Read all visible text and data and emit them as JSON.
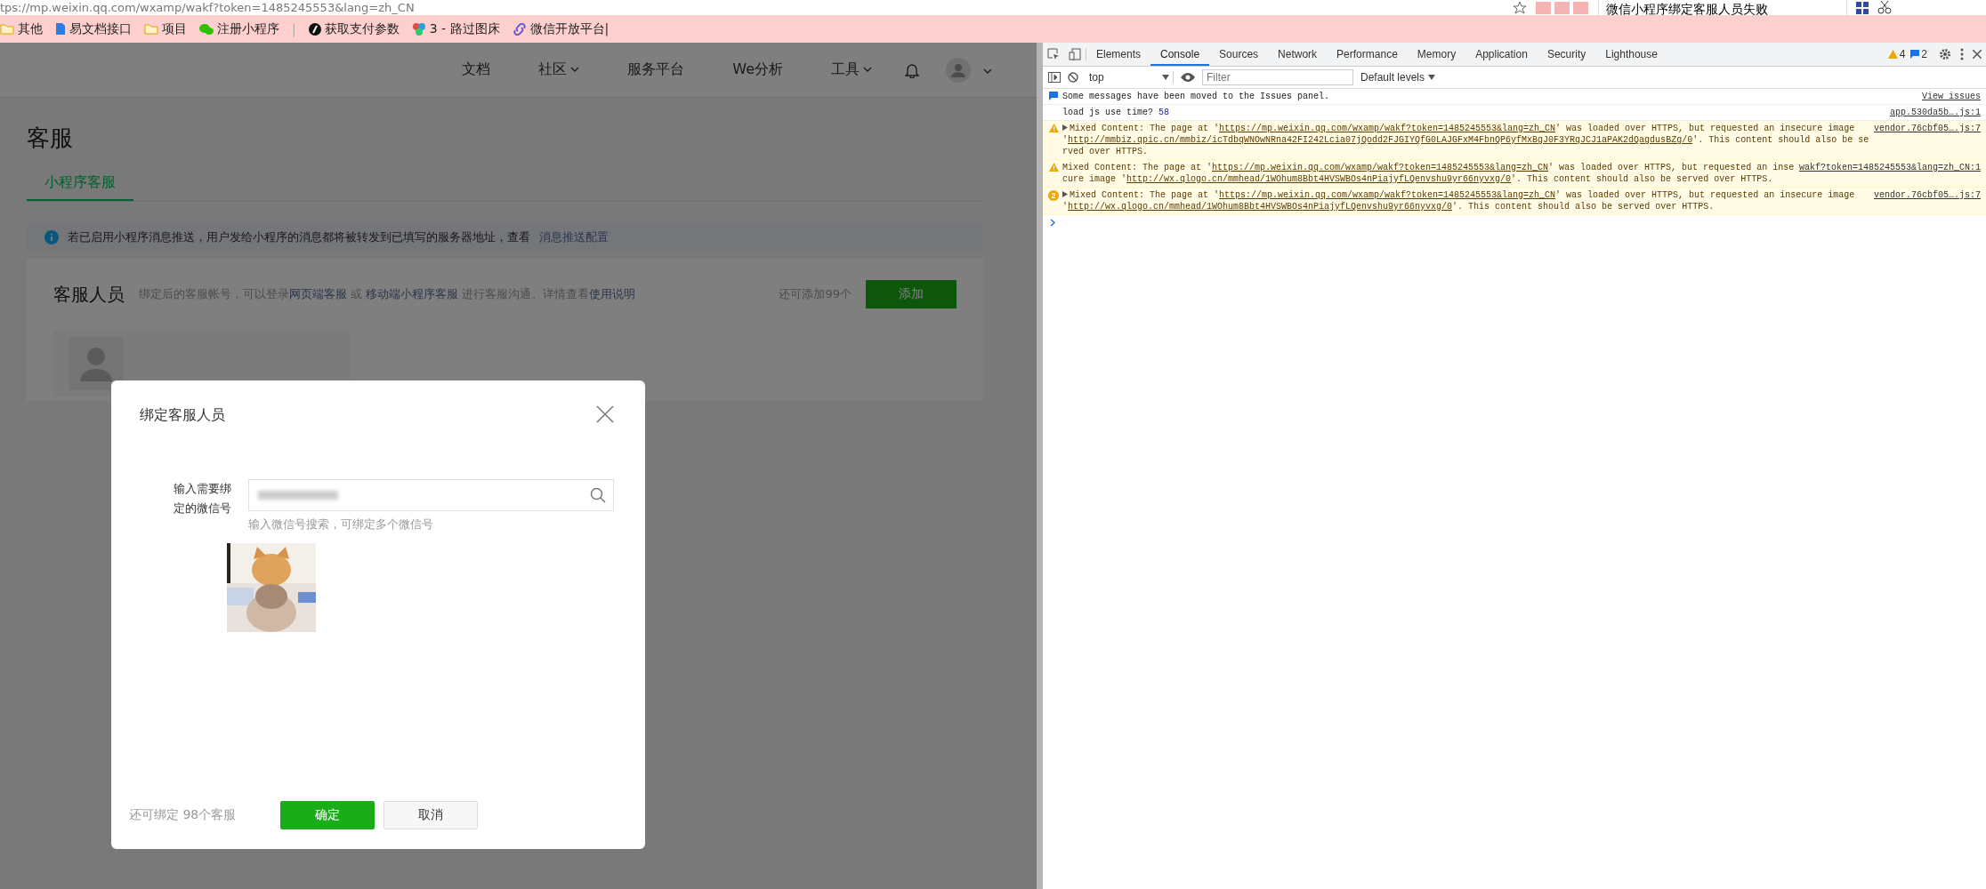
{
  "browser": {
    "address": "tps://mp.weixin.qq.com/wxamp/wakf?token=1485245553&lang=zh_CN",
    "tab_title": "微信小程序绑定客服人员失败",
    "bookmarks": [
      {
        "kind": "folder",
        "label": "其他"
      },
      {
        "kind": "doc",
        "label": "易文档接口"
      },
      {
        "kind": "folder",
        "label": "项目"
      },
      {
        "kind": "chat",
        "label": "注册小程序"
      },
      {
        "kind": "separator",
        "label": "|"
      },
      {
        "kind": "badge",
        "label": "获取支付参数"
      },
      {
        "kind": "dots",
        "label": "3 - 路过图床"
      },
      {
        "kind": "link",
        "label": "微信开放平台|"
      }
    ]
  },
  "site_nav": [
    {
      "label": "文档",
      "dropdown": false
    },
    {
      "label": "社区",
      "dropdown": true
    },
    {
      "label": "服务平台",
      "dropdown": false
    },
    {
      "label": "We分析",
      "dropdown": false
    },
    {
      "label": "工具",
      "dropdown": true
    }
  ],
  "page": {
    "title": "客服",
    "tabs": [
      {
        "label": "小程序客服",
        "selected": true
      }
    ],
    "notice": {
      "text": "若已启用小程序消息推送，用户发给小程序的消息都将被转发到已填写的服务器地址，查看",
      "link": "消息推送配置"
    },
    "staff": {
      "title": "客服人员",
      "description": [
        {
          "text": "绑定后的客服帐号，可以登录",
          "link": false
        },
        {
          "text": "网页端客服",
          "link": true
        },
        {
          "text": " 或 ",
          "link": false
        },
        {
          "text": "移动端小程序客服",
          "link": true
        },
        {
          "text": " 进行客服沟通。详情查看",
          "link": false
        },
        {
          "text": "使用说明",
          "link": true
        }
      ],
      "remaining": "还可添加99个",
      "add_button": "添加"
    }
  },
  "dialog": {
    "title": "绑定客服人员",
    "field_label": "输入需要绑定的微信号",
    "hint": "输入微信号搜索，可绑定多个微信号",
    "remaining": "还可绑定 98个客服",
    "confirm": "确定",
    "cancel": "取消"
  },
  "devtools": {
    "tabs": [
      {
        "label": "Elements",
        "selected": false
      },
      {
        "label": "Console",
        "selected": true
      },
      {
        "label": "Sources",
        "selected": false
      },
      {
        "label": "Network",
        "selected": false
      },
      {
        "label": "Performance",
        "selected": false
      },
      {
        "label": "Memory",
        "selected": false
      },
      {
        "label": "Application",
        "selected": false
      },
      {
        "label": "Security",
        "selected": false
      },
      {
        "label": "Lighthouse",
        "selected": false
      }
    ],
    "warning_count": "4",
    "issue_count": "2",
    "context": "top",
    "filter_placeholder": "Filter",
    "levels": "Default levels",
    "messages": [
      {
        "kind": "info",
        "parts": [
          {
            "text": "Some messages have been moved to the Issues panel.",
            "link": false
          }
        ],
        "source": "View issues",
        "expandable": false
      },
      {
        "kind": "log",
        "parts": [
          {
            "text": "load js use time? ",
            "link": false
          }
        ],
        "value": "58",
        "source": "app.530da5b….js:1",
        "expandable": false
      },
      {
        "kind": "warning",
        "parts": [
          {
            "text": "Mixed Content: The page at '",
            "link": false
          },
          {
            "text": "https://mp.weixin.qq.com/wxamp/wakf?token=1485245553&lang=zh_CN",
            "link": true
          },
          {
            "text": "' was loaded over HTTPS, but requested an insecure image '",
            "link": false
          },
          {
            "text": "http://mmbiz.qpic.cn/mmbiz/icTdbqWNOwNRna42FI242Lcia07jQodd2FJGIYQfG0LAJGFxM4FbnQP6yfMxBgJ0F3YRqJCJ1aPAK2dQagdusBZg/0",
            "link": true
          },
          {
            "text": "'. This content should also be served over HTTPS.",
            "link": false
          }
        ],
        "source": "vendor.76cbf05….js:7",
        "expandable": true
      },
      {
        "kind": "warning",
        "parts": [
          {
            "text": "Mixed Content: The page at '",
            "link": false
          },
          {
            "text": "https://mp.weixin.qq.com/wxamp/wakf?token=1485245553&lang=zh_CN",
            "link": true
          },
          {
            "text": "' was loaded over HTTPS, but requested an insecure image '",
            "link": false
          },
          {
            "text": "http://wx.qlogo.cn/mmhead/1WOhum8Bbt4HVSWBOs4nPiajyfLQenvshu9yr66nyvxg/0",
            "link": true
          },
          {
            "text": "'. This content should also be served over HTTPS.",
            "link": false
          }
        ],
        "source": "wakf?token=1485245553&lang=zh_CN:1",
        "expandable": false
      },
      {
        "kind": "warning",
        "count": "2",
        "parts": [
          {
            "text": "Mixed Content: The page at '",
            "link": false
          },
          {
            "text": "https://mp.weixin.qq.com/wxamp/wakf?token=1485245553&lang=zh_CN",
            "link": true
          },
          {
            "text": "' was loaded over HTTPS, but requested an insecure image '",
            "link": false
          },
          {
            "text": "http://wx.qlogo.cn/mmhead/1WOhum8Bbt4HVSWBOs4nPiajyfLQenvshu9yr66nyvxg/0",
            "link": true
          },
          {
            "text": "'. This content should also be served over HTTPS.",
            "link": false
          }
        ],
        "source": "vendor.76cbf05….js:7",
        "expandable": true
      }
    ]
  }
}
